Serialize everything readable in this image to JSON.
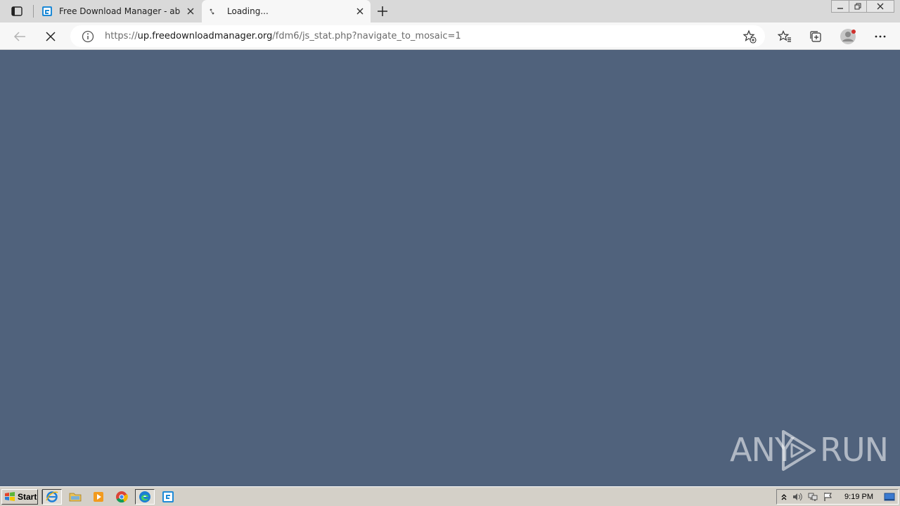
{
  "browser": {
    "tabs": [
      {
        "title": "Free Download Manager - absolu",
        "active": false
      },
      {
        "title": "Loading...",
        "active": true
      }
    ],
    "address": {
      "scheme": "https://",
      "host": "up.freedownloadmanager.org",
      "path": "/fdm6/js_stat.php?navigate_to_mosaic=1"
    }
  },
  "content": {
    "background": "#50627c",
    "watermark_left": "ANY",
    "watermark_right": "RUN"
  },
  "taskbar": {
    "start_label": "Start",
    "clock": "9:19 PM"
  },
  "icons": {
    "tab_actions": "tab-actions-icon",
    "back": "back-arrow-icon",
    "stop": "stop-x-icon",
    "info": "site-info-icon",
    "add_favorite": "star-plus-icon",
    "favorites": "favorites-icon",
    "collections": "collections-icon",
    "profile": "profile-avatar-icon",
    "menu": "more-dots-icon"
  }
}
